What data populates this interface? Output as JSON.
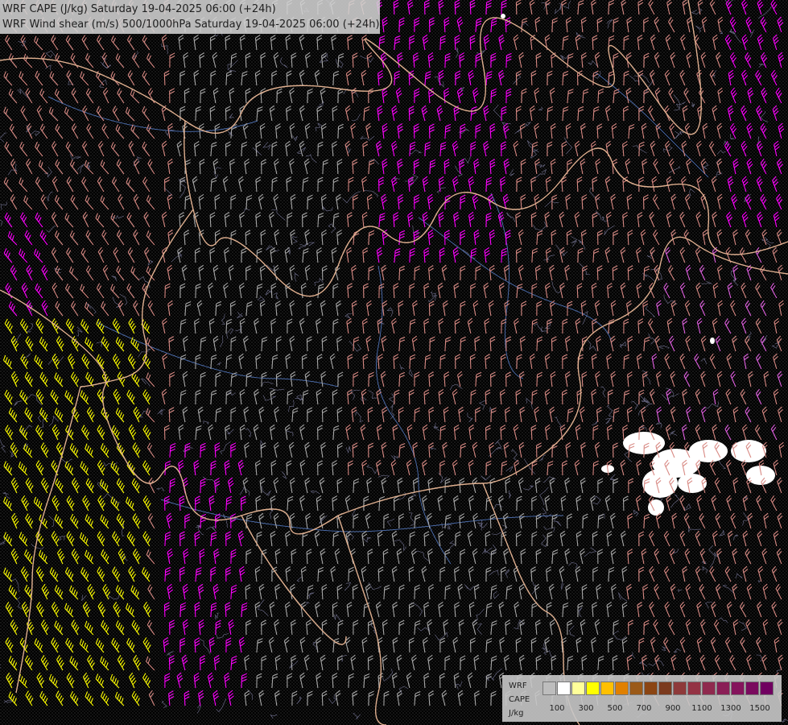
{
  "header": {
    "line1": "WRF CAPE (J/kg) Saturday 19-04-2025 06:00 (+24h)",
    "line2": "WRF Wind shear (m/s) 500/1000hPa Saturday 19-04-2025 06:00 (+24h)"
  },
  "legend": {
    "model": "WRF",
    "variable": "CAPE",
    "unit": "J/kg",
    "swatch_colors": [
      "#bdbdbd",
      "#ffffff",
      "#ffff9a",
      "#ffff00",
      "#ffc000",
      "#e08000",
      "#9b5a18",
      "#8b4513",
      "#7b3a1e",
      "#8e3a3a",
      "#943344",
      "#8f2a4e",
      "#8a1e56",
      "#85145c",
      "#7a0a5e",
      "#700060"
    ],
    "ticks": [
      "100",
      "300",
      "500",
      "700",
      "900",
      "1100",
      "1300",
      "1500"
    ]
  },
  "barb_colors": {
    "low": "#a8a8a8",
    "mid": "#d88a84",
    "high": "#e060e0",
    "strong": "#ff00ff",
    "extreme": "#ffff00"
  },
  "map_colors": {
    "background": "#000000",
    "borders": "#e0b090",
    "rivers": "#4a6aa8",
    "terrain_contours": "#8a8ab0",
    "cape_low": "#ffffff"
  }
}
